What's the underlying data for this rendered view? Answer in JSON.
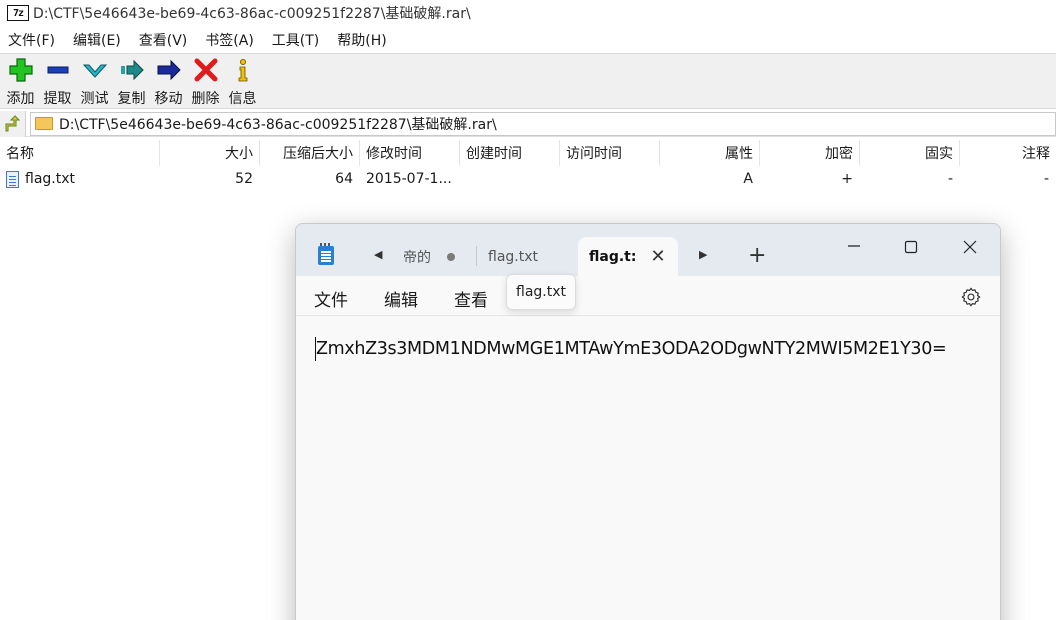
{
  "archive_window": {
    "app_icon_text": "7z",
    "title": "D:\\CTF\\5e46643e-be69-4c63-86ac-c009251f2287\\基础破解.rar\\",
    "menu": [
      "文件(F)",
      "编辑(E)",
      "查看(V)",
      "书签(A)",
      "工具(T)",
      "帮助(H)"
    ],
    "toolbar": [
      {
        "label": "添加",
        "icon": "add-icon",
        "color": "#1ebd1e"
      },
      {
        "label": "提取",
        "icon": "extract-icon",
        "color": "#1b3fb8"
      },
      {
        "label": "测试",
        "icon": "test-icon",
        "color": "#1aa7b8"
      },
      {
        "label": "复制",
        "icon": "copy-icon",
        "color": "#1b8a8a"
      },
      {
        "label": "移动",
        "icon": "move-icon",
        "color": "#1b2a9a"
      },
      {
        "label": "删除",
        "icon": "delete-icon",
        "color": "#e01b1b"
      },
      {
        "label": "信息",
        "icon": "info-icon",
        "color": "#e0b000"
      }
    ],
    "address": "D:\\CTF\\5e46643e-be69-4c63-86ac-c009251f2287\\基础破解.rar\\",
    "columns": [
      "名称",
      "大小",
      "压缩后大小",
      "修改时间",
      "创建时间",
      "访问时间",
      "属性",
      "加密",
      "固实",
      "注释"
    ],
    "files": [
      {
        "name": "flag.txt",
        "size": "52",
        "packed": "64",
        "modified": "2015-07-1...",
        "created": "",
        "accessed": "",
        "attr": "A",
        "encrypted": "+",
        "solid": "-",
        "comment": "-"
      }
    ]
  },
  "notepad": {
    "tabs": [
      {
        "label": "帝的",
        "modified": true
      },
      {
        "label": "flag.txt"
      },
      {
        "label": "flag.t:",
        "active": true
      }
    ],
    "new_tab": "+",
    "menu": [
      "文件",
      "编辑",
      "查看"
    ],
    "tooltip": "flag.txt",
    "content": "ZmxhZ3s3MDM1NDMwMGE1MTAwYmE3ODA2ODgwNTY2MWI5M2E1Y30="
  }
}
